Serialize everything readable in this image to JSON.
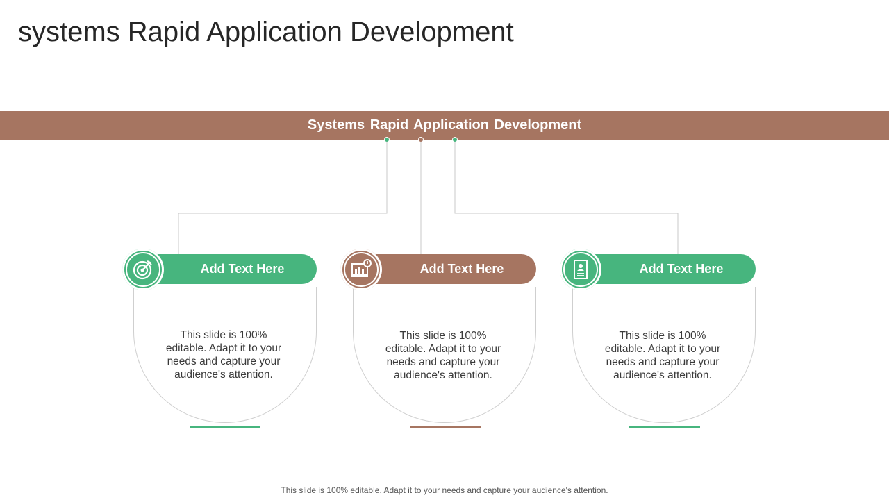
{
  "title": "systems Rapid Application Development",
  "banner": "Systems Rapid Application Development",
  "colors": {
    "green": "#47b57e",
    "brown": "#a67561"
  },
  "cards": [
    {
      "label": "Add Text Here",
      "body": "This slide is 100% editable. Adapt it to your needs and capture your audience's attention.",
      "icon": "target-icon",
      "color": "green"
    },
    {
      "label": "Add Text Here",
      "body": "This slide is 100% editable. Adapt it to your needs and capture your audience's attention.",
      "icon": "dashboard-icon",
      "color": "brown"
    },
    {
      "label": "Add Text Here",
      "body": "This slide is 100% editable. Adapt it to your needs and capture your audience's attention.",
      "icon": "document-icon",
      "color": "green"
    }
  ],
  "footer": "This slide is 100% editable. Adapt it to your needs and capture your audience's attention."
}
